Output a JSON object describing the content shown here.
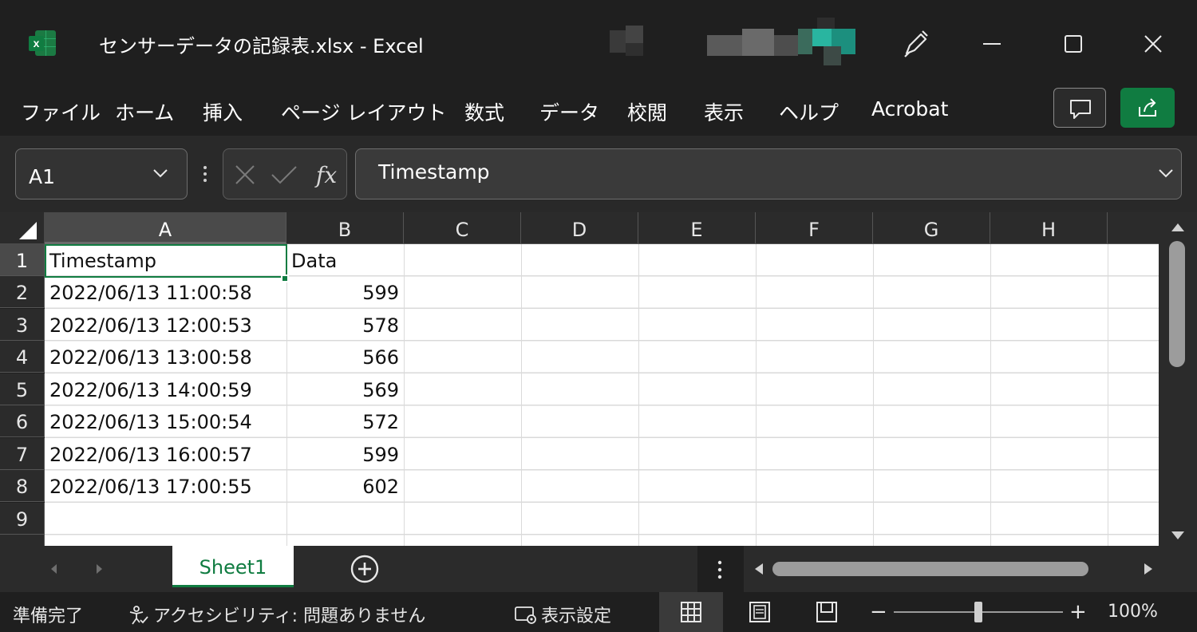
{
  "window": {
    "title": "センサーデータの記録表.xlsx  -  Excel",
    "accent_color": "#107c41"
  },
  "ribbon": {
    "tabs": [
      "ファイル",
      "ホーム",
      "挿入",
      "ページ レイアウト",
      "数式",
      "データ",
      "校閲",
      "表示",
      "ヘルプ",
      "Acrobat"
    ]
  },
  "formula_bar": {
    "name_box": "A1",
    "formula": "Timestamp"
  },
  "grid": {
    "columns": [
      "A",
      "B",
      "C",
      "D",
      "E",
      "F",
      "G",
      "H"
    ],
    "rows": [
      "1",
      "2",
      "3",
      "4",
      "5",
      "6",
      "7",
      "8",
      "9"
    ],
    "header": {
      "a": "Timestamp",
      "b": "Data"
    },
    "data": [
      {
        "timestamp": "2022/06/13 11:00:58",
        "value": "599"
      },
      {
        "timestamp": "2022/06/13 12:00:53",
        "value": "578"
      },
      {
        "timestamp": "2022/06/13 13:00:58",
        "value": "566"
      },
      {
        "timestamp": "2022/06/13 14:00:59",
        "value": "569"
      },
      {
        "timestamp": "2022/06/13 15:00:54",
        "value": "572"
      },
      {
        "timestamp": "2022/06/13 16:00:57",
        "value": "599"
      },
      {
        "timestamp": "2022/06/13 17:00:55",
        "value": "602"
      }
    ]
  },
  "sheets": {
    "active": "Sheet1"
  },
  "status": {
    "ready": "準備完了",
    "accessibility": "アクセシビリティ: 問題ありません",
    "display_settings": "表示設定",
    "zoom": "100%",
    "zoom_minus": "−",
    "zoom_plus": "+"
  }
}
